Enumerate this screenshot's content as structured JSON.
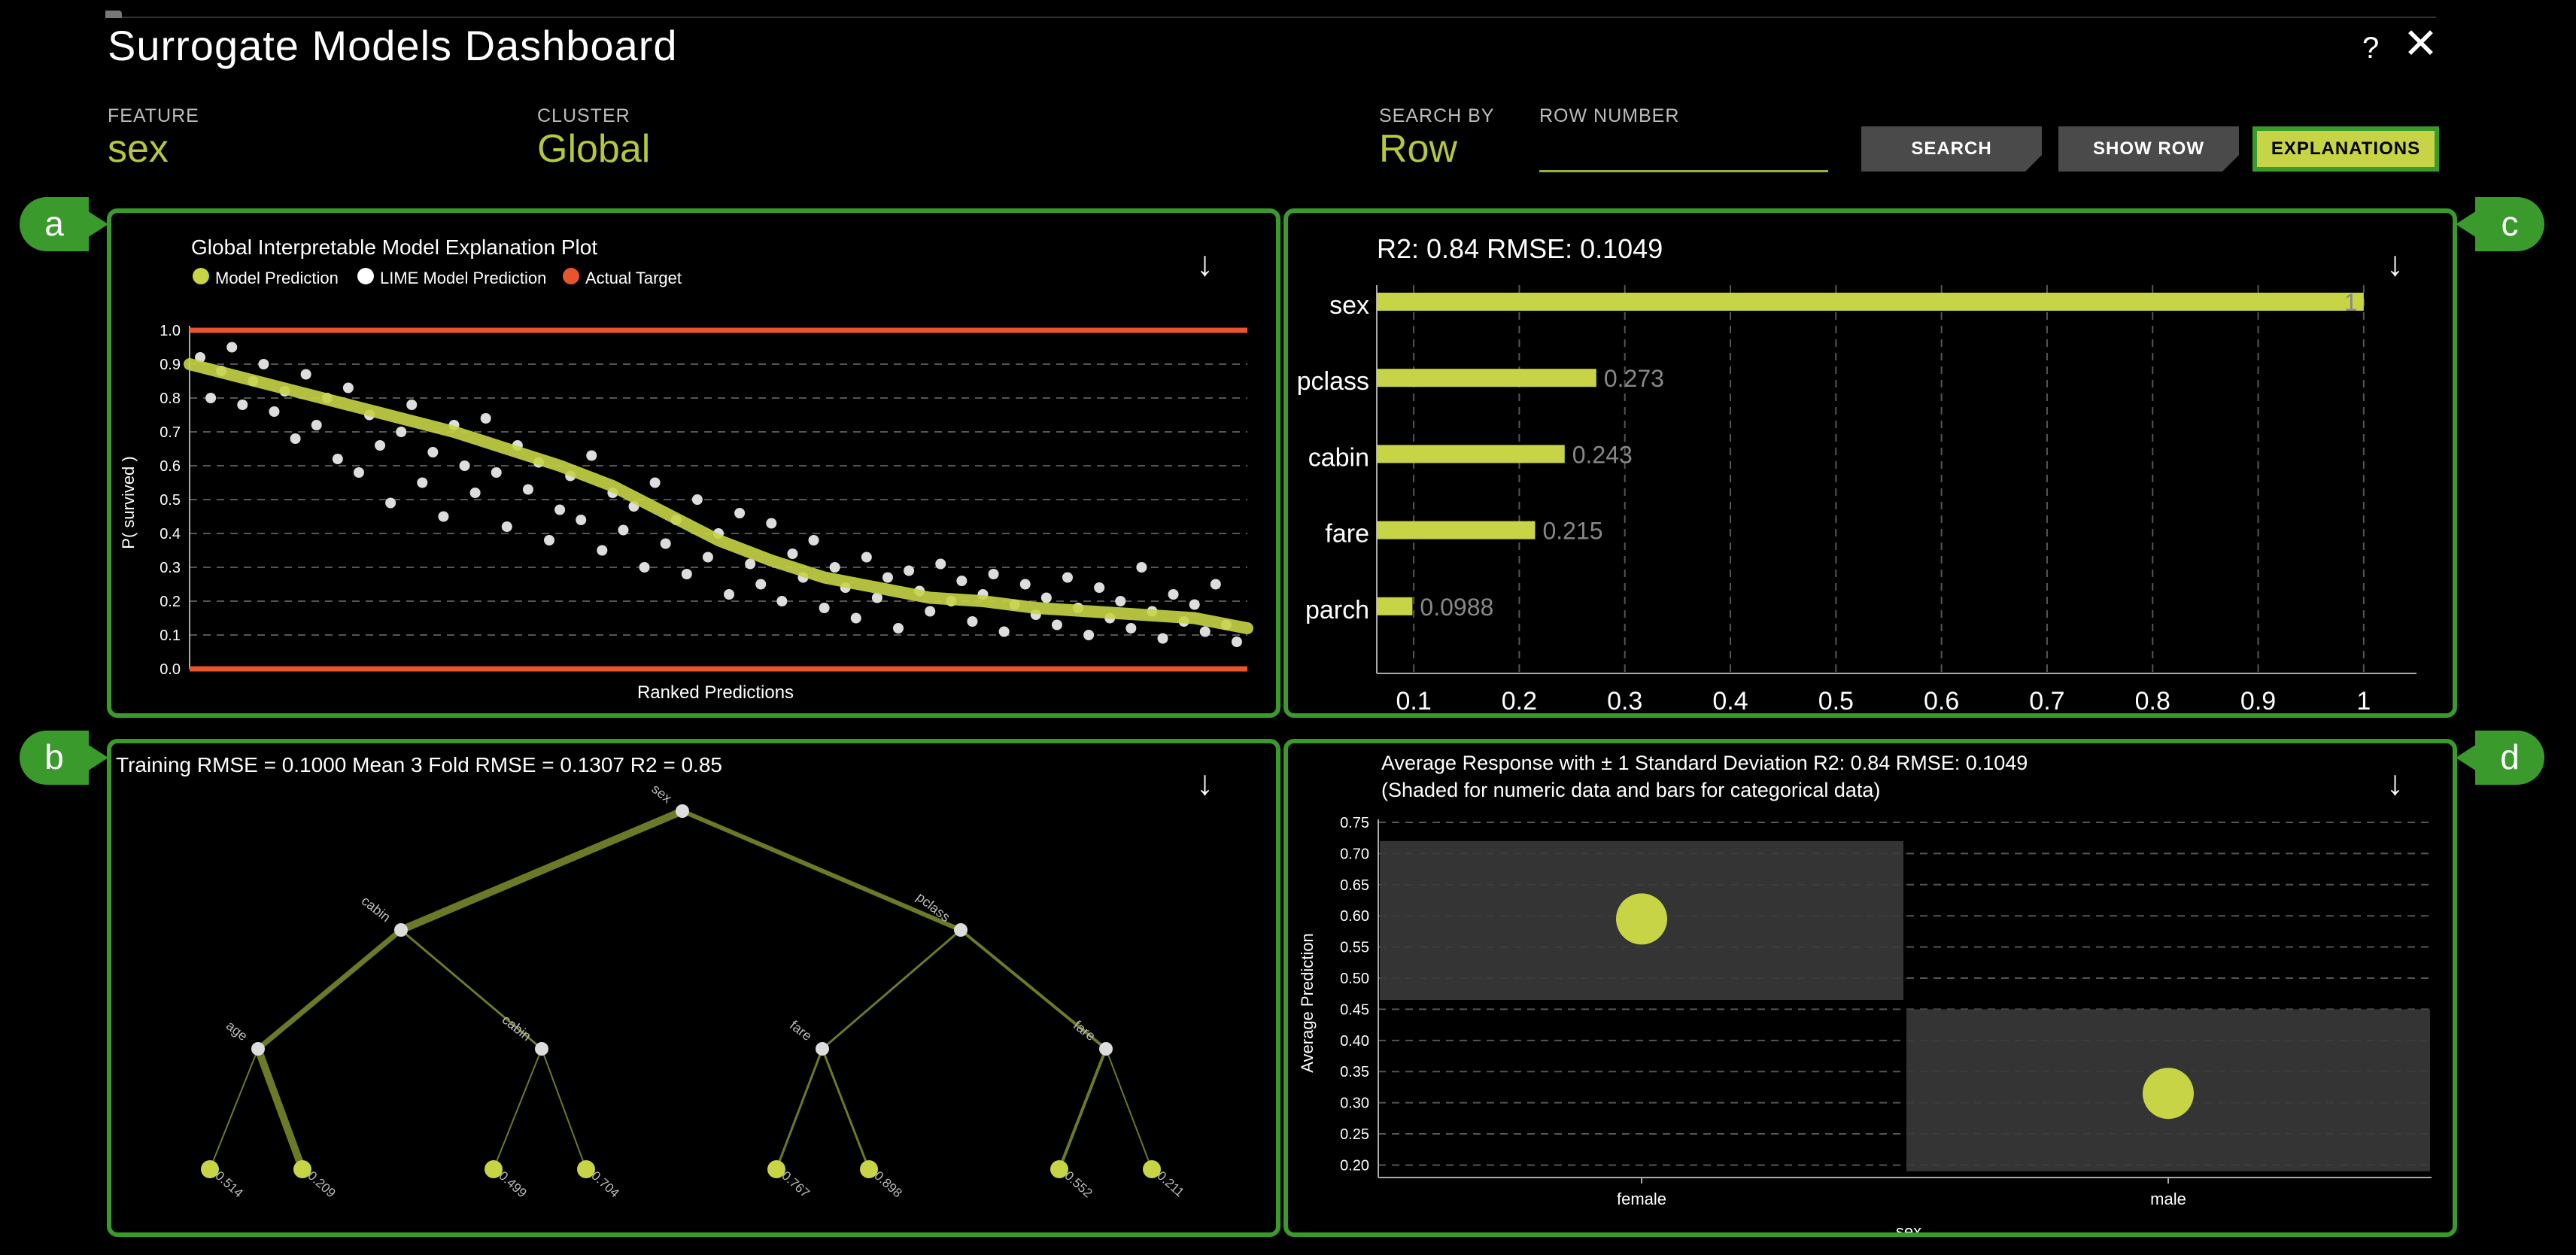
{
  "app": {
    "title": "Surrogate Models Dashboard",
    "help_label": "?",
    "close_label": "✕"
  },
  "controls": {
    "feature": {
      "label": "FEATURE",
      "value": "sex"
    },
    "cluster": {
      "label": "CLUSTER",
      "value": "Global"
    },
    "search_by": {
      "label": "SEARCH BY",
      "value": "Row"
    },
    "row_number": {
      "label": "ROW NUMBER",
      "value": "",
      "placeholder": ""
    },
    "buttons": {
      "search": "SEARCH",
      "show_row": "SHOW ROW",
      "explanations": "EXPLANATIONS"
    }
  },
  "colors": {
    "accent": "#c7d445",
    "panel_border": "#3a9a2b",
    "target": "#e8542e",
    "lime_point": "#ffffff",
    "tree_edge": "#6a7a26",
    "bar_bg": "#3a3a3a"
  },
  "icons": {
    "download": "download-arrow-icon",
    "close": "close-icon",
    "help": "help-icon"
  },
  "download_label": "↓",
  "panels": {
    "a": {
      "badge": "a",
      "chart_data": {
        "type": "scatter",
        "title": "Global Interpretable Model Explanation Plot",
        "xlabel": "Ranked Predictions",
        "ylabel": "P( survived )",
        "ylim": [
          0,
          1
        ],
        "yticks": [
          "0.0",
          "0.1",
          "0.2",
          "0.3",
          "0.4",
          "0.5",
          "0.6",
          "0.7",
          "0.8",
          "0.9",
          "1.0"
        ],
        "grid": "horizontal dashed",
        "legend_position": "top-left",
        "legend": [
          "Model Prediction",
          "LIME Model Prediction",
          "Actual Target"
        ],
        "series": [
          {
            "name": "Model Prediction",
            "kind": "line",
            "x": [
              0,
              0.05,
              0.1,
              0.15,
              0.2,
              0.25,
              0.3,
              0.35,
              0.4,
              0.45,
              0.5,
              0.55,
              0.6,
              0.65,
              0.7,
              0.75,
              0.8,
              0.85,
              0.9,
              0.95,
              1
            ],
            "y": [
              0.9,
              0.86,
              0.82,
              0.78,
              0.74,
              0.7,
              0.65,
              0.6,
              0.54,
              0.46,
              0.38,
              0.32,
              0.27,
              0.24,
              0.21,
              0.2,
              0.18,
              0.17,
              0.16,
              0.15,
              0.12
            ]
          },
          {
            "name": "LIME Model Prediction",
            "kind": "scatter",
            "x": [
              0.01,
              0.02,
              0.03,
              0.04,
              0.05,
              0.06,
              0.07,
              0.08,
              0.09,
              0.1,
              0.11,
              0.12,
              0.13,
              0.14,
              0.15,
              0.16,
              0.17,
              0.18,
              0.19,
              0.2,
              0.21,
              0.22,
              0.23,
              0.24,
              0.25,
              0.26,
              0.27,
              0.28,
              0.29,
              0.3,
              0.31,
              0.32,
              0.33,
              0.34,
              0.35,
              0.36,
              0.37,
              0.38,
              0.39,
              0.4,
              0.41,
              0.42,
              0.43,
              0.44,
              0.45,
              0.46,
              0.47,
              0.48,
              0.49,
              0.5,
              0.51,
              0.52,
              0.53,
              0.54,
              0.55,
              0.56,
              0.57,
              0.58,
              0.59,
              0.6,
              0.61,
              0.62,
              0.63,
              0.64,
              0.65,
              0.66,
              0.67,
              0.68,
              0.69,
              0.7,
              0.71,
              0.72,
              0.73,
              0.74,
              0.75,
              0.76,
              0.77,
              0.78,
              0.79,
              0.8,
              0.81,
              0.82,
              0.83,
              0.84,
              0.85,
              0.86,
              0.87,
              0.88,
              0.89,
              0.9,
              0.91,
              0.92,
              0.93,
              0.94,
              0.95,
              0.96,
              0.97,
              0.98,
              0.99
            ],
            "y": [
              0.92,
              0.8,
              0.88,
              0.95,
              0.78,
              0.85,
              0.9,
              0.76,
              0.82,
              0.68,
              0.87,
              0.72,
              0.8,
              0.62,
              0.83,
              0.58,
              0.75,
              0.66,
              0.49,
              0.7,
              0.78,
              0.55,
              0.64,
              0.45,
              0.72,
              0.6,
              0.52,
              0.74,
              0.58,
              0.42,
              0.66,
              0.53,
              0.61,
              0.38,
              0.47,
              0.57,
              0.44,
              0.63,
              0.35,
              0.52,
              0.41,
              0.48,
              0.3,
              0.55,
              0.37,
              0.44,
              0.28,
              0.5,
              0.33,
              0.4,
              0.22,
              0.46,
              0.31,
              0.25,
              0.43,
              0.2,
              0.34,
              0.27,
              0.38,
              0.18,
              0.3,
              0.24,
              0.15,
              0.33,
              0.21,
              0.27,
              0.12,
              0.29,
              0.23,
              0.17,
              0.31,
              0.2,
              0.26,
              0.14,
              0.22,
              0.28,
              0.11,
              0.19,
              0.25,
              0.16,
              0.21,
              0.13,
              0.27,
              0.18,
              0.1,
              0.24,
              0.15,
              0.2,
              0.12,
              0.3,
              0.17,
              0.09,
              0.22,
              0.14,
              0.19,
              0.11,
              0.25,
              0.13,
              0.08
            ]
          },
          {
            "name": "Actual Target",
            "kind": "scatter",
            "y_values": [
              0,
              1
            ]
          }
        ]
      }
    },
    "b": {
      "badge": "b",
      "stats": "Training RMSE = 0.1000 Mean 3 Fold RMSE = 0.1307 R2 = 0.85",
      "tree": {
        "nodes": [
          {
            "id": "root",
            "label": "sex"
          },
          {
            "id": "l",
            "label": "cabin"
          },
          {
            "id": "r",
            "label": "pclass"
          },
          {
            "id": "ll",
            "label": "age"
          },
          {
            "id": "lr",
            "label": "cabin"
          },
          {
            "id": "rl",
            "label": "fare"
          },
          {
            "id": "rr",
            "label": "fare"
          }
        ],
        "leaves": [
          "0.514",
          "0.209",
          "0.499",
          "0.704",
          "0.767",
          "0.898",
          "0.552",
          "0.211"
        ]
      }
    },
    "c": {
      "badge": "c",
      "chart_data": {
        "type": "bar",
        "orientation": "horizontal",
        "title": "R2: 0.84 RMSE: 0.1049",
        "categories": [
          "sex",
          "pclass",
          "cabin",
          "fare",
          "parch"
        ],
        "values": [
          1,
          0.273,
          0.243,
          0.215,
          0.0988
        ],
        "value_labels": [
          "1",
          "0.273",
          "0.243",
          "0.215",
          "0.0988"
        ],
        "xticks": [
          "0.1",
          "0.2",
          "0.3",
          "0.4",
          "0.5",
          "0.6",
          "0.7",
          "0.8",
          "0.9",
          "1"
        ],
        "xlim": [
          0.065,
          1.05
        ],
        "grid": "vertical dashed"
      }
    },
    "d": {
      "badge": "d",
      "chart_data": {
        "type": "scatter",
        "title": "Average Response with ± 1 Standard Deviation R2: 0.84 RMSE: 0.1049",
        "subtitle": "(Shaded for numeric data and bars for categorical data)",
        "xlabel": "sex",
        "ylabel": "Average Prediction",
        "ylim": [
          0.18,
          0.75
        ],
        "yticks": [
          "0.75",
          "0.70",
          "0.65",
          "0.60",
          "0.55",
          "0.50",
          "0.45",
          "0.40",
          "0.35",
          "0.30",
          "0.25",
          "0.20"
        ],
        "categories": [
          "female",
          "male"
        ],
        "values": [
          0.595,
          0.315
        ],
        "band_low": [
          0.465,
          0.19
        ],
        "band_high": [
          0.72,
          0.45
        ],
        "grid": "horizontal dashed"
      }
    }
  }
}
